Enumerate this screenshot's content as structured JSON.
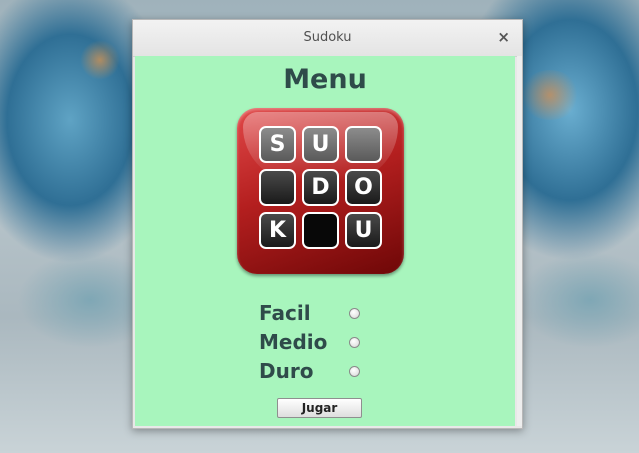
{
  "window": {
    "title": "Sudoku",
    "close_glyph": "×"
  },
  "menu": {
    "title": "Menu"
  },
  "logo": {
    "cells": [
      "S",
      "U",
      "",
      "",
      "D",
      "O",
      "K",
      "",
      "U"
    ]
  },
  "options": [
    {
      "label": "Facil",
      "selected": false
    },
    {
      "label": "Medio",
      "selected": false
    },
    {
      "label": "Duro",
      "selected": false
    }
  ],
  "play_button": {
    "label": "Jugar"
  }
}
